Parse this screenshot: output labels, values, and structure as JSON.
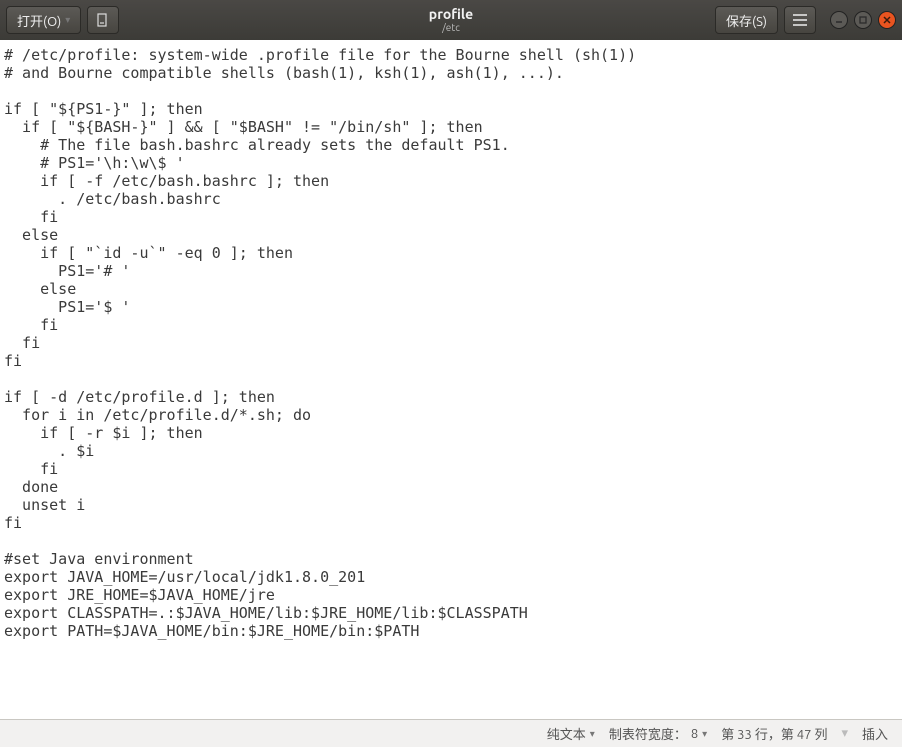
{
  "titlebar": {
    "open_label": "打开(O)",
    "title": "profile",
    "subtitle": "/etc",
    "save_label": "保存(S)"
  },
  "editor": {
    "content": "# /etc/profile: system-wide .profile file for the Bourne shell (sh(1))\n# and Bourne compatible shells (bash(1), ksh(1), ash(1), ...).\n\nif [ \"${PS1-}\" ]; then\n  if [ \"${BASH-}\" ] && [ \"$BASH\" != \"/bin/sh\" ]; then\n    # The file bash.bashrc already sets the default PS1.\n    # PS1='\\h:\\w\\$ '\n    if [ -f /etc/bash.bashrc ]; then\n      . /etc/bash.bashrc\n    fi\n  else\n    if [ \"`id -u`\" -eq 0 ]; then\n      PS1='# '\n    else\n      PS1='$ '\n    fi\n  fi\nfi\n\nif [ -d /etc/profile.d ]; then\n  for i in /etc/profile.d/*.sh; do\n    if [ -r $i ]; then\n      . $i\n    fi\n  done\n  unset i\nfi\n\n#set Java environment\nexport JAVA_HOME=/usr/local/jdk1.8.0_201\nexport JRE_HOME=$JAVA_HOME/jre\nexport CLASSPATH=.:$JAVA_HOME/lib:$JRE_HOME/lib:$CLASSPATH\nexport PATH=$JAVA_HOME/bin:$JRE_HOME/bin:$PATH"
  },
  "statusbar": {
    "syntax": "纯文本",
    "tab_label": "制表符宽度：",
    "tab_value": "8",
    "position": "第 33 行，第 47 列",
    "mode": "插入"
  }
}
